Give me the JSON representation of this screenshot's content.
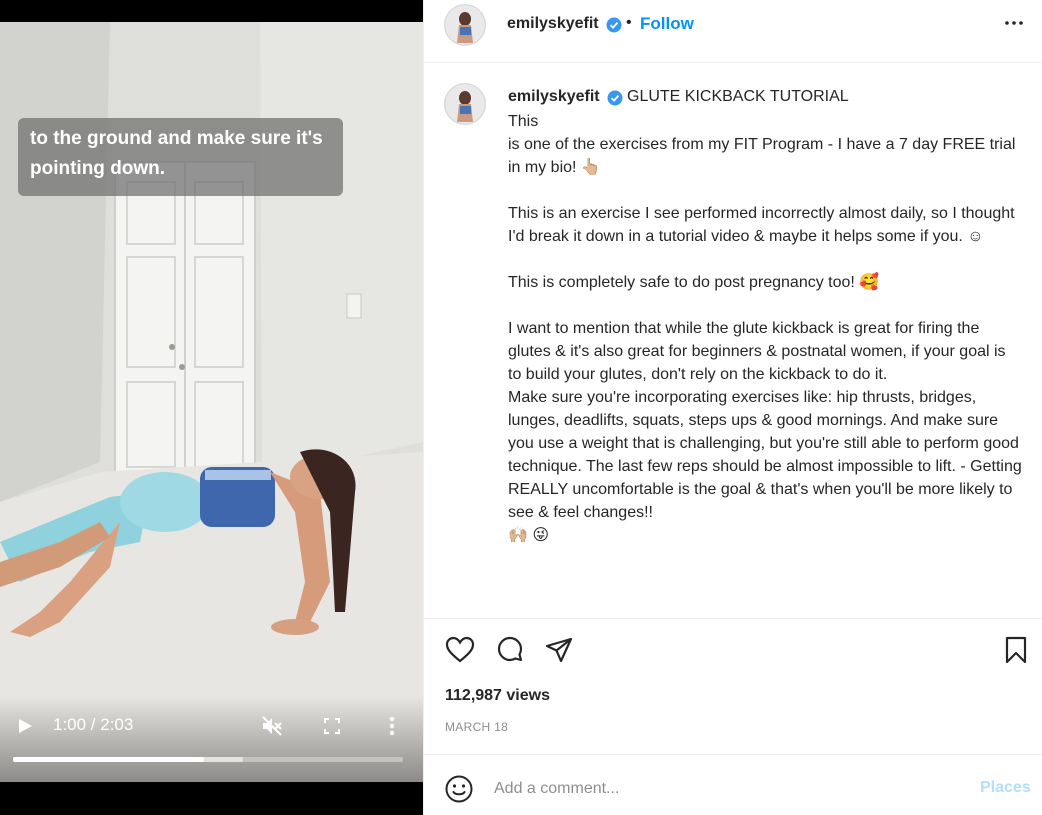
{
  "video": {
    "caption_overlay": "to the ground and make sure it's pointing down.",
    "time": "1:00 / 2:03",
    "progress": 0.49,
    "buffered": 0.59,
    "icons": {
      "play": "play-icon",
      "mute": "muted-speaker-icon",
      "fullscreen": "fullscreen-icon",
      "menu": "vertical-dots-icon"
    }
  },
  "header": {
    "username": "emilyskyefit",
    "separator": "•",
    "follow_label": "Follow"
  },
  "post": {
    "username": "emilyskyefit",
    "title": "GLUTE KICKBACK TUTORIAL",
    "caption": "This\nis one of the exercises from my FIT Program - I have a 7 day FREE trial in my bio! 👆🏼\n\nThis is an exercise I see performed incorrectly almost daily, so I thought I'd break it down in a tutorial video & maybe it helps some if you. ☺\n\nThis is completely safe to do post pregnancy too! 🥰\n\nI want to mention that while the glute kickback is great for firing the glutes & it's also great for beginners & postnatal women, if your goal is to build your glutes, don't rely on the kickback to do it.\nMake sure you're incorporating exercises like: hip thrusts, bridges, lunges, deadlifts, squats, steps ups & good mornings. And make sure you use a weight that is challenging, but you're still able to perform good technique. The last few reps should be almost impossible to lift. - Getting REALLY uncomfortable is the goal & that's when you'll be more likely to see & feel changes!!\n🙌🏼 😜"
  },
  "stats": {
    "views": "112,987 views",
    "date": "MARCH 18"
  },
  "comment": {
    "placeholder": "Add a comment...",
    "post_label": "Places"
  },
  "colors": {
    "accent": "#0095f6",
    "verified": "#3897f0",
    "post_disabled": "#b2dffc"
  }
}
